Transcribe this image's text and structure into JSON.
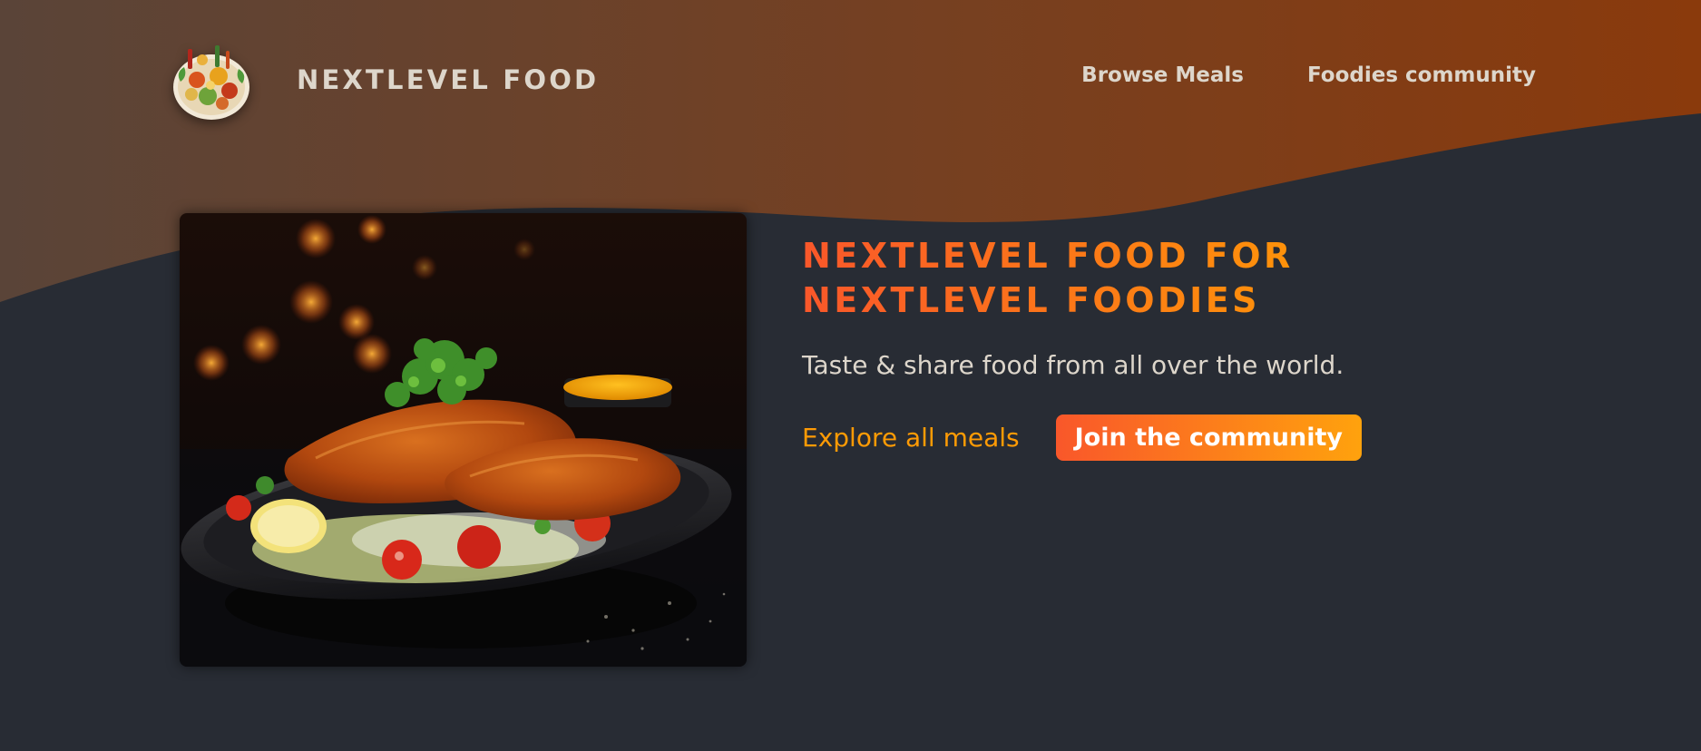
{
  "header": {
    "logo_alt": "A plate with food on it",
    "logo_text": "NextLevel Food",
    "nav": [
      {
        "label": "Browse Meals"
      },
      {
        "label": "Foodies community"
      }
    ]
  },
  "hero": {
    "image_alt": "A delicious breaded schnitzel with salad",
    "title": "NextLevel Food for NextLevel Foodies",
    "subtitle": "Taste & share food from all over the world.",
    "explore_label": "Explore all meals",
    "join_label": "Join the community"
  },
  "colors": {
    "background": "#282c34",
    "header_gradient_start": "#5a4438",
    "header_gradient_end": "#8a3a0c",
    "accent_start": "#f9572a",
    "accent_end": "#ff9b05",
    "nav_text": "#ddd6cb"
  },
  "icons": {
    "logo": "food-plate-icon"
  }
}
